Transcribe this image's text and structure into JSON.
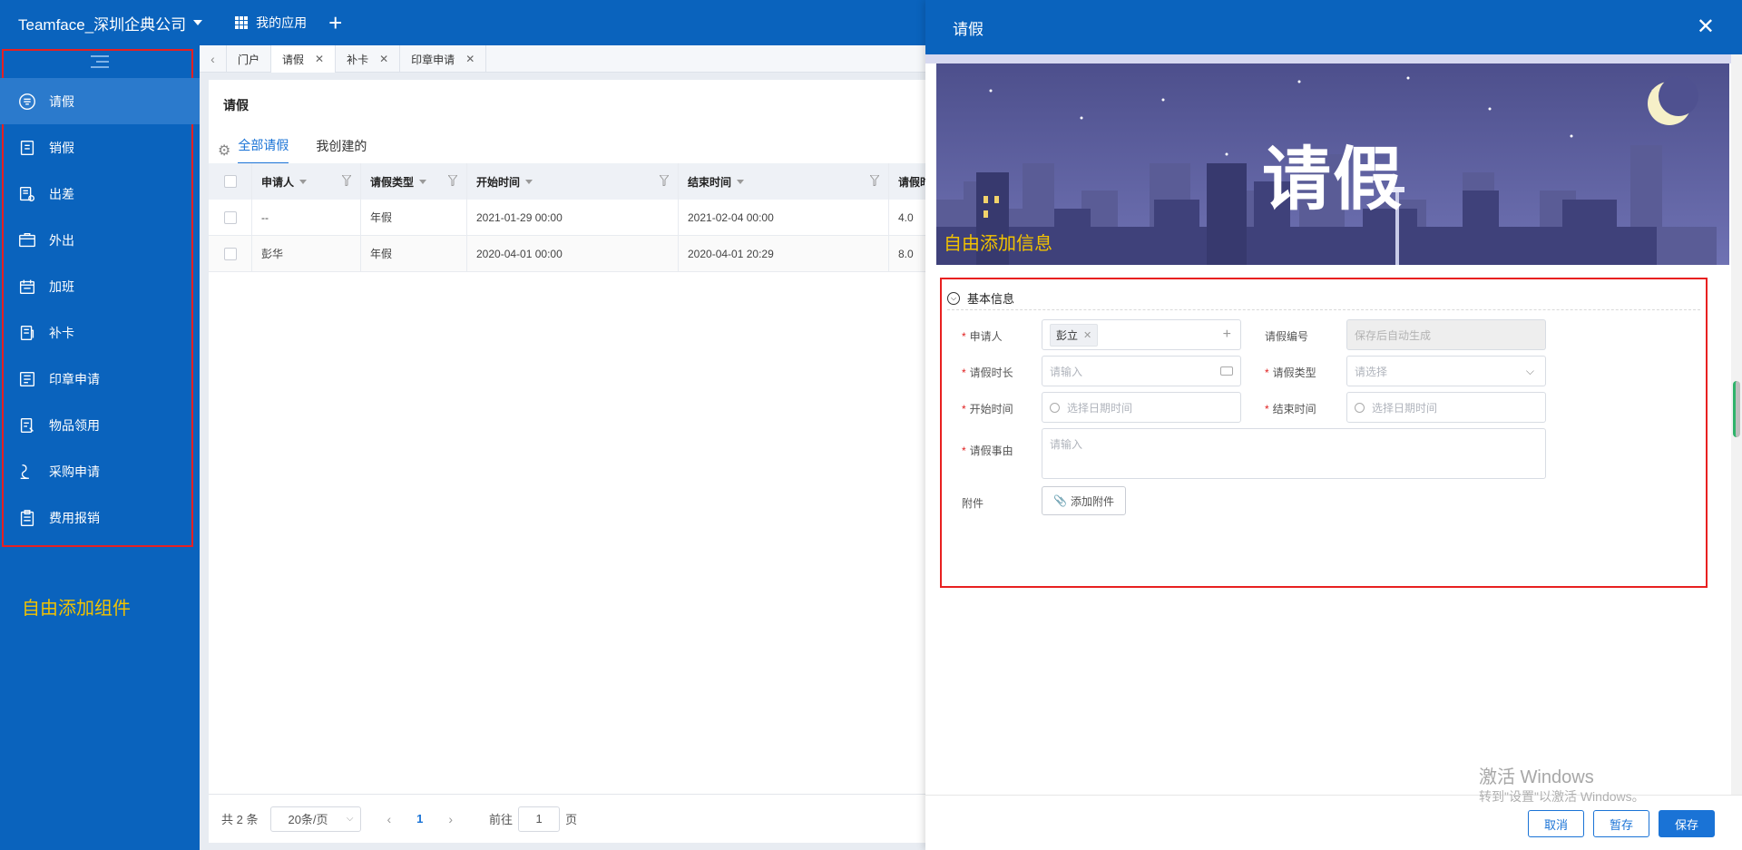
{
  "topbar": {
    "company": "Teamface_深圳企典公司",
    "apps_label": "我的应用"
  },
  "sidebar": {
    "items": [
      {
        "label": "请假",
        "icon": "leave-icon"
      },
      {
        "label": "销假",
        "icon": "cancel-leave-icon"
      },
      {
        "label": "出差",
        "icon": "business-trip-icon"
      },
      {
        "label": "外出",
        "icon": "go-out-icon"
      },
      {
        "label": "加班",
        "icon": "overtime-icon"
      },
      {
        "label": "补卡",
        "icon": "card-fix-icon"
      },
      {
        "label": "印章申请",
        "icon": "seal-icon"
      },
      {
        "label": "物品领用",
        "icon": "goods-icon"
      },
      {
        "label": "采购申请",
        "icon": "purchase-icon"
      },
      {
        "label": "费用报销",
        "icon": "expense-icon"
      }
    ],
    "note": "自由添加组件"
  },
  "tabs": [
    {
      "label": "门户",
      "closable": false
    },
    {
      "label": "请假",
      "closable": true
    },
    {
      "label": "补卡",
      "closable": true
    },
    {
      "label": "印章申请",
      "closable": true
    }
  ],
  "list": {
    "title": "请假",
    "subtabs": [
      "全部请假",
      "我创建的"
    ],
    "columns": [
      "申请人",
      "请假类型",
      "开始时间",
      "结束时间",
      "请假时"
    ],
    "rows": [
      [
        "--",
        "年假",
        "2021-01-29 00:00",
        "2021-02-04 00:00",
        "4.0"
      ],
      [
        "彭华",
        "年假",
        "2020-04-01 00:00",
        "2020-04-01 20:29",
        "8.0"
      ]
    ],
    "pager": {
      "total": "共 2 条",
      "page_size": "20条/页",
      "current": "1",
      "goto_prefix": "前往",
      "goto_value": "1",
      "goto_suffix": "页"
    }
  },
  "drawer": {
    "title": "请假",
    "banner_title": "请假",
    "banner_note": "自由添加信息",
    "section": "基本信息",
    "fields": {
      "applicant_label": "申请人",
      "applicant_value": "彭立",
      "number_label": "请假编号",
      "number_placeholder": "保存后自动生成",
      "duration_label": "请假时长",
      "duration_placeholder": "请输入",
      "type_label": "请假类型",
      "type_placeholder": "请选择",
      "start_label": "开始时间",
      "start_placeholder": "选择日期时间",
      "end_label": "结束时间",
      "end_placeholder": "选择日期时间",
      "reason_label": "请假事由",
      "reason_placeholder": "请输入",
      "attach_label": "附件",
      "attach_button": "添加附件"
    },
    "buttons": {
      "cancel": "取消",
      "draft": "暂存",
      "save": "保存"
    }
  },
  "watermark": {
    "line1": "激活 Windows",
    "line2": "转到\"设置\"以激活 Windows。"
  },
  "colors": {
    "brand_blue": "#0a63bd",
    "accent_blue": "#1a73d6",
    "highlight_yellow": "#f2c200",
    "annotation_red": "#e82020",
    "banner_purple": "#5d5f9e"
  }
}
